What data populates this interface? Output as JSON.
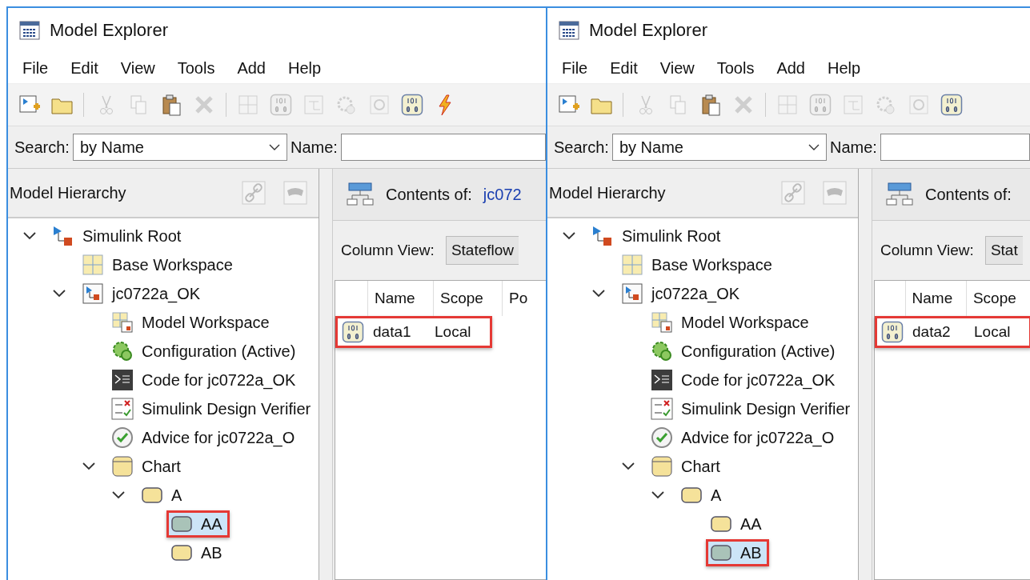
{
  "windows": [
    {
      "title": "Model Explorer",
      "menu": [
        "File",
        "Edit",
        "View",
        "Tools",
        "Add",
        "Help"
      ],
      "toolbar": [
        {
          "kind": "new-model",
          "disabled": false
        },
        {
          "kind": "open",
          "disabled": false
        },
        {
          "kind": "cut",
          "disabled": true
        },
        {
          "kind": "copy",
          "disabled": true
        },
        {
          "kind": "paste",
          "disabled": false
        },
        {
          "kind": "delete",
          "disabled": true
        },
        {
          "kind": "grid",
          "disabled": true
        },
        {
          "kind": "data",
          "disabled": true
        },
        {
          "kind": "event",
          "disabled": true
        },
        {
          "kind": "config",
          "disabled": true
        },
        {
          "kind": "gear",
          "disabled": true
        },
        {
          "kind": "data",
          "disabled": false
        },
        {
          "kind": "bolt",
          "disabled": false
        }
      ],
      "search": {
        "label": "Search:",
        "value": "by Name",
        "name_label": "Name:"
      },
      "hierarchy": {
        "title": "Model Hierarchy",
        "tree": [
          {
            "label": "Simulink Root",
            "kind": "root",
            "expanded": true,
            "selected": false,
            "highlighted": false,
            "children": [
              {
                "label": "Base Workspace",
                "kind": "workspace",
                "selected": false,
                "highlighted": false
              },
              {
                "label": "jc0722a_OK",
                "kind": "model",
                "expanded": true,
                "selected": false,
                "highlighted": false,
                "children": [
                  {
                    "label": "Model Workspace",
                    "kind": "model-workspace",
                    "selected": false,
                    "highlighted": false
                  },
                  {
                    "label": "Configuration (Active)",
                    "kind": "config",
                    "selected": false,
                    "highlighted": false
                  },
                  {
                    "label": "Code for jc0722a_OK",
                    "kind": "code",
                    "selected": false,
                    "highlighted": false
                  },
                  {
                    "label": "Simulink Design Verifier",
                    "kind": "verifier",
                    "selected": false,
                    "highlighted": false
                  },
                  {
                    "label": "Advice for jc0722a_O",
                    "kind": "advice",
                    "selected": false,
                    "highlighted": false
                  },
                  {
                    "label": "Chart",
                    "kind": "chart",
                    "expanded": true,
                    "selected": false,
                    "highlighted": false,
                    "children": [
                      {
                        "label": "A",
                        "kind": "state",
                        "expanded": true,
                        "selected": false,
                        "highlighted": false,
                        "children": [
                          {
                            "label": "AA",
                            "kind": "state",
                            "selected": true,
                            "highlighted": true
                          },
                          {
                            "label": "AB",
                            "kind": "state",
                            "selected": false,
                            "highlighted": false
                          }
                        ]
                      }
                    ]
                  }
                ]
              }
            ]
          }
        ]
      },
      "contents": {
        "label": "Contents of:",
        "path": "jc072",
        "column_view_label": "Column View:",
        "column_view": "Stateflow",
        "columns": [
          "Name",
          "Scope",
          "Po"
        ],
        "rows": [
          {
            "name": "data1",
            "scope": "Local",
            "highlighted": true
          }
        ]
      }
    },
    {
      "title": "Model Explorer",
      "menu": [
        "File",
        "Edit",
        "View",
        "Tools",
        "Add",
        "Help"
      ],
      "toolbar": [
        {
          "kind": "new-model",
          "disabled": false
        },
        {
          "kind": "open",
          "disabled": false
        },
        {
          "kind": "cut",
          "disabled": true
        },
        {
          "kind": "copy",
          "disabled": true
        },
        {
          "kind": "paste",
          "disabled": false
        },
        {
          "kind": "delete",
          "disabled": true
        },
        {
          "kind": "grid",
          "disabled": true
        },
        {
          "kind": "data",
          "disabled": true
        },
        {
          "kind": "event",
          "disabled": true
        },
        {
          "kind": "config",
          "disabled": true
        },
        {
          "kind": "gear",
          "disabled": true
        },
        {
          "kind": "data",
          "disabled": false
        }
      ],
      "search": {
        "label": "Search:",
        "value": "by Name",
        "name_label": "Name:"
      },
      "hierarchy": {
        "title": "Model Hierarchy",
        "tree": [
          {
            "label": "Simulink Root",
            "kind": "root",
            "expanded": true,
            "selected": false,
            "highlighted": false,
            "children": [
              {
                "label": "Base Workspace",
                "kind": "workspace",
                "selected": false,
                "highlighted": false
              },
              {
                "label": "jc0722a_OK",
                "kind": "model",
                "expanded": true,
                "selected": false,
                "highlighted": false,
                "children": [
                  {
                    "label": "Model Workspace",
                    "kind": "model-workspace",
                    "selected": false,
                    "highlighted": false
                  },
                  {
                    "label": "Configuration (Active)",
                    "kind": "config",
                    "selected": false,
                    "highlighted": false
                  },
                  {
                    "label": "Code for jc0722a_OK",
                    "kind": "code",
                    "selected": false,
                    "highlighted": false
                  },
                  {
                    "label": "Simulink Design Verifier",
                    "kind": "verifier",
                    "selected": false,
                    "highlighted": false
                  },
                  {
                    "label": "Advice for jc0722a_O",
                    "kind": "advice",
                    "selected": false,
                    "highlighted": false
                  },
                  {
                    "label": "Chart",
                    "kind": "chart",
                    "expanded": true,
                    "selected": false,
                    "highlighted": false,
                    "children": [
                      {
                        "label": "A",
                        "kind": "state",
                        "expanded": true,
                        "selected": false,
                        "highlighted": false,
                        "children": [
                          {
                            "label": "AA",
                            "kind": "state",
                            "selected": false,
                            "highlighted": false
                          },
                          {
                            "label": "AB",
                            "kind": "state",
                            "selected": true,
                            "highlighted": true
                          }
                        ]
                      }
                    ]
                  }
                ]
              }
            ]
          }
        ]
      },
      "contents": {
        "label": "Contents of:",
        "column_view_label": "Column View:",
        "column_view": "Stat",
        "columns": [
          "Name",
          "Scope"
        ],
        "rows": [
          {
            "name": "data2",
            "scope": "Local",
            "highlighted": true
          }
        ]
      }
    }
  ]
}
